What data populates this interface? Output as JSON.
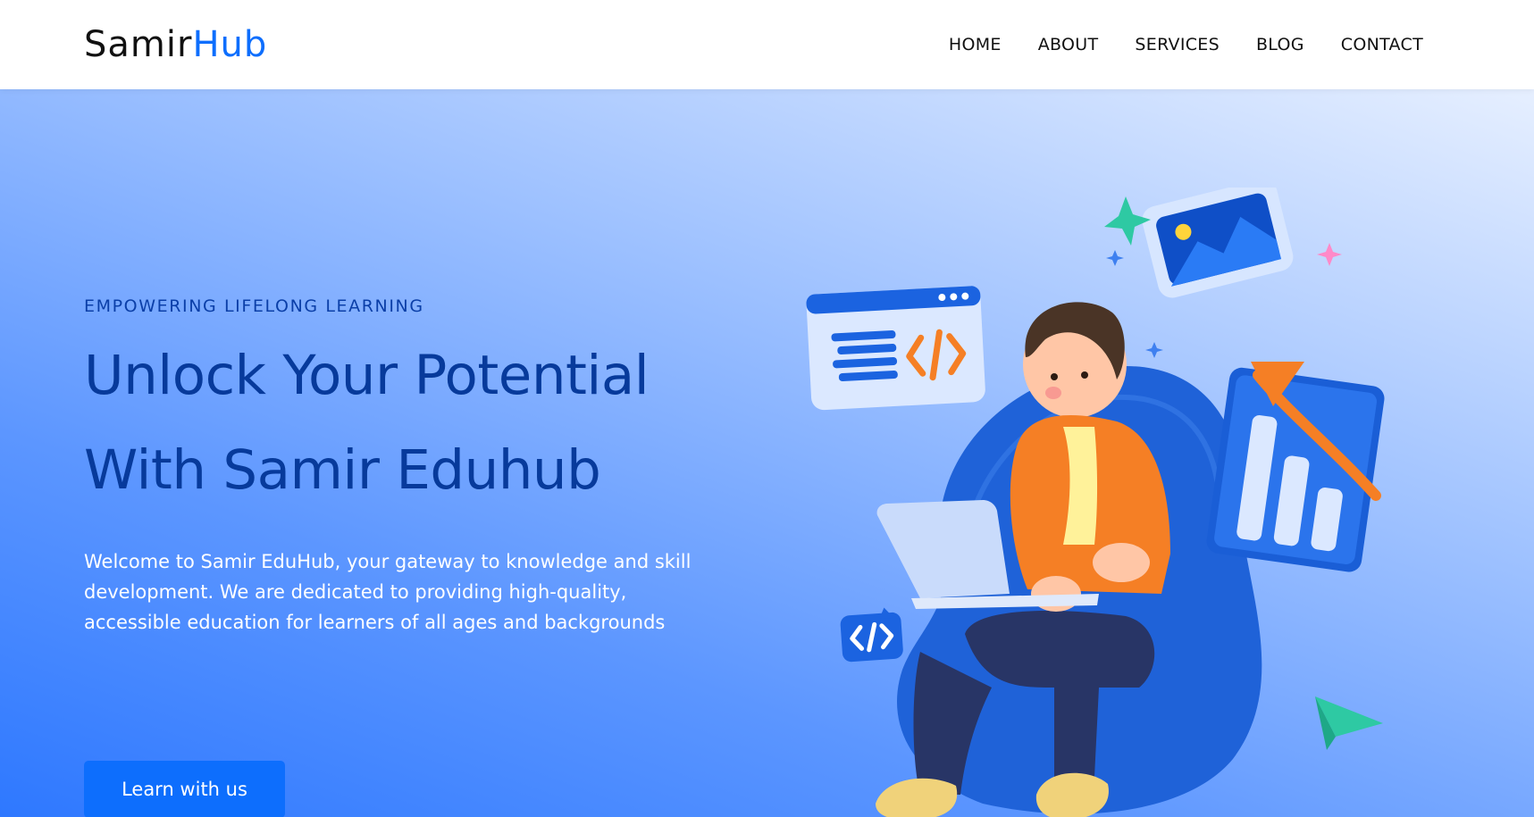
{
  "brand": {
    "name_part1": "Samir",
    "name_part2": "Hub"
  },
  "nav": {
    "items": [
      {
        "label": "HOME"
      },
      {
        "label": "ABOUT"
      },
      {
        "label": "SERVICES"
      },
      {
        "label": "BLOG"
      },
      {
        "label": "CONTACT"
      }
    ]
  },
  "hero": {
    "eyebrow": "EMPOWERING LIFELONG LEARNING",
    "headline_line1": "Unlock Your Potential",
    "headline_line2": "With Samir Eduhub",
    "description": "Welcome to Samir EduHub, your gateway to knowledge and skill development. We are dedicated to providing high-quality, accessible education for learners of all ages and backgrounds",
    "cta_label": "Learn with us"
  },
  "colors": {
    "accent": "#0d6efd",
    "headline": "#073a9b",
    "eyebrow": "#0b3fa8",
    "orange": "#f57f25",
    "teal": "#2ec9a3"
  },
  "illustration": {
    "icons": [
      "code-window-icon",
      "image-card-icon",
      "bar-chart-icon",
      "code-bubble-icon",
      "paper-plane-icon",
      "sparkle-icon"
    ]
  }
}
